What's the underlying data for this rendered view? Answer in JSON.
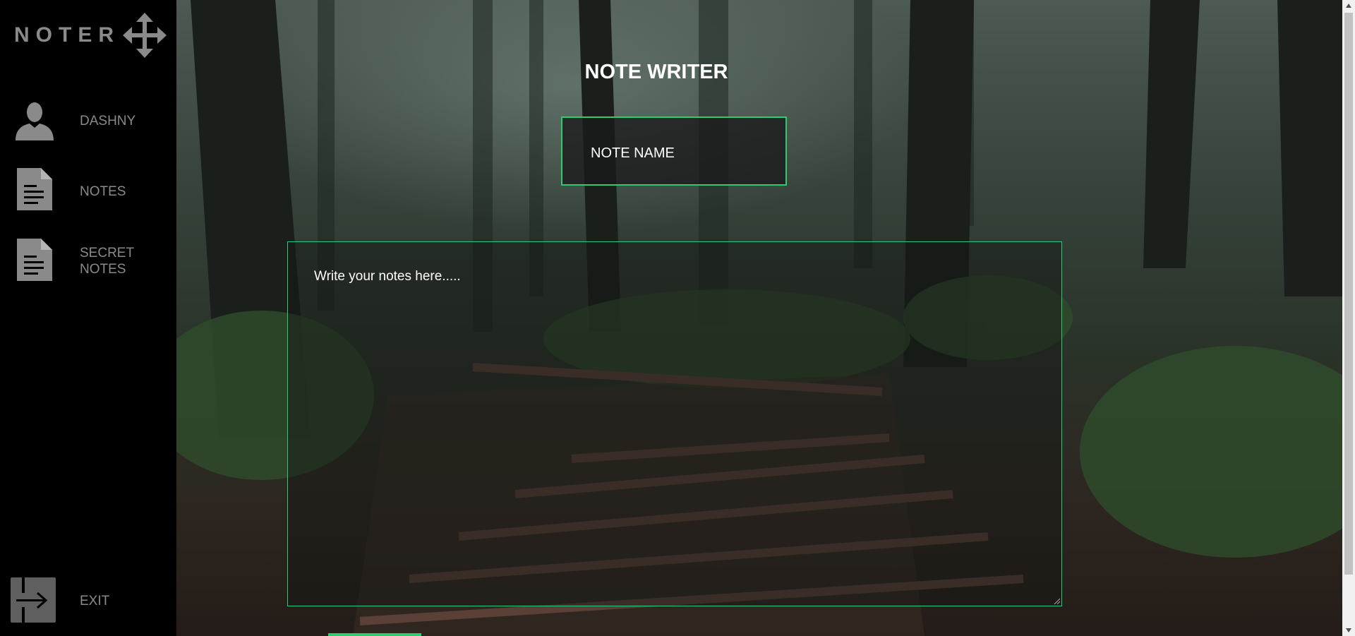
{
  "app": {
    "logo_text": "NOTER",
    "logo_icon": "move-arrows-icon"
  },
  "sidebar": {
    "items": [
      {
        "label": "DASHNY",
        "icon": "user-silhouette-icon"
      },
      {
        "label": "NOTES",
        "icon": "document-icon"
      },
      {
        "label": "SECRET NOTES",
        "icon": "document-icon"
      }
    ],
    "exit": {
      "label": "EXIT",
      "icon": "exit-arrow-icon"
    }
  },
  "main": {
    "title": "NOTE WRITER",
    "note_name": {
      "placeholder": "NOTE NAME",
      "value": ""
    },
    "notes": {
      "placeholder": "Write your notes here.....",
      "value": ""
    }
  },
  "colors": {
    "accent": "#2ecc71",
    "sidebar_bg": "#000000",
    "sidebar_text": "#8a8a8a",
    "title_text": "#ffffff"
  }
}
